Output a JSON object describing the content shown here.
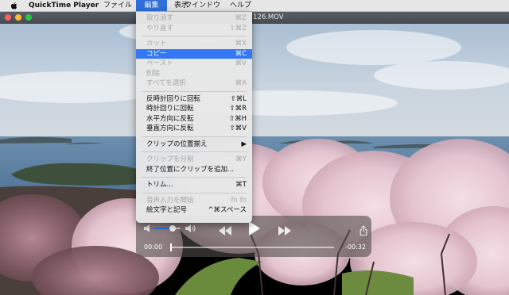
{
  "menubar": {
    "app_name": "QuickTime Player",
    "menus": [
      "ファイル",
      "編集",
      "表示",
      "ウインドウ",
      "ヘルプ"
    ],
    "active_menu": "編集"
  },
  "window": {
    "title": "126.MOV"
  },
  "edit_menu": {
    "items": [
      {
        "label": "取り消す",
        "shortcut": "⌘Z",
        "enabled": false
      },
      {
        "label": "やり直す",
        "shortcut": "⇧⌘Z",
        "enabled": false
      },
      {
        "separator": true
      },
      {
        "label": "カット",
        "shortcut": "⌘X",
        "enabled": false
      },
      {
        "label": "コピー",
        "shortcut": "⌘C",
        "enabled": true,
        "highlighted": true
      },
      {
        "label": "ペースト",
        "shortcut": "⌘V",
        "enabled": false
      },
      {
        "label": "削除",
        "shortcut": "",
        "enabled": false
      },
      {
        "label": "すべてを選択",
        "shortcut": "⌘A",
        "enabled": false
      },
      {
        "separator": true
      },
      {
        "label": "反時計回りに回転",
        "shortcut": "⇧⌘L",
        "enabled": true
      },
      {
        "label": "時計回りに回転",
        "shortcut": "⇧⌘R",
        "enabled": true
      },
      {
        "label": "水平方向に反転",
        "shortcut": "⇧⌘H",
        "enabled": true
      },
      {
        "label": "垂直方向に反転",
        "shortcut": "⇧⌘V",
        "enabled": true
      },
      {
        "separator": true
      },
      {
        "label": "クリップの位置揃え",
        "shortcut": "▶",
        "enabled": true
      },
      {
        "separator": true
      },
      {
        "label": "クリップを分割",
        "shortcut": "⌘Y",
        "enabled": false
      },
      {
        "label": "終了位置にクリップを追加...",
        "shortcut": "",
        "enabled": true
      },
      {
        "separator": true
      },
      {
        "label": "トリム...",
        "shortcut": "⌘T",
        "enabled": true
      },
      {
        "separator": true
      },
      {
        "label": "音声入力を開始",
        "shortcut": "fn fn",
        "enabled": false
      },
      {
        "label": "絵文字と記号",
        "shortcut": "^⌘スペース",
        "enabled": true
      }
    ]
  },
  "player": {
    "current_time": "00:00",
    "remaining_time": "-00:32",
    "volume_level": 0.7,
    "playback_progress": 0.0
  },
  "colors": {
    "menu_highlight": "#3478f6",
    "active_menu_bg": "#2f6fd8",
    "close": "#fe5f57",
    "minimize": "#febc2e",
    "zoom": "#28c840"
  },
  "icons": {
    "apple": "apple-logo-icon",
    "volume_low": "speaker-low-icon",
    "volume_high": "speaker-high-icon",
    "rewind": "rewind-icon",
    "play": "play-icon",
    "fast_forward": "fast-forward-icon",
    "share": "share-icon"
  }
}
